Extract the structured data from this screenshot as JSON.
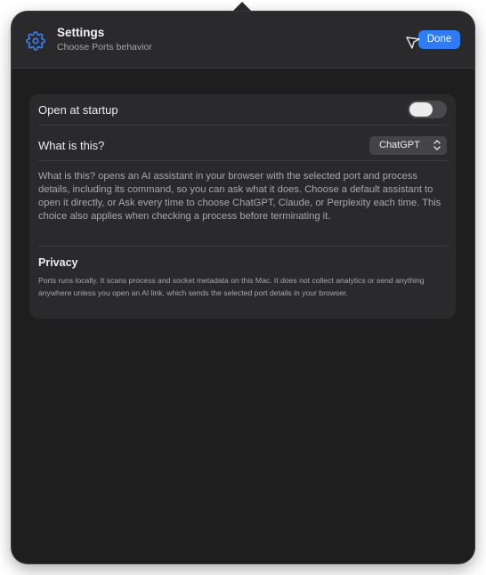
{
  "header": {
    "title": "Settings",
    "subtitle": "Choose Ports behavior",
    "done_label": "Done",
    "settings_icon": "gear-icon",
    "cursor_icon": "pointer-cursor-icon"
  },
  "settings": {
    "open_at_startup": {
      "label": "Open at startup",
      "enabled": false
    },
    "what_is_this": {
      "label": "What is this?",
      "selected": "ChatGPT"
    },
    "description": "What is this? opens an AI assistant in your browser with the selected port and process details, including its command, so you can ask what it does. Choose a default assistant to open it directly, or Ask every time to choose ChatGPT, Claude, or Perplexity each time. This choice also applies when checking a process before terminating it."
  },
  "privacy": {
    "title": "Privacy",
    "text": "Ports runs locally. It scans process and socket metadata on this Mac. It does not collect analytics or send anything anywhere unless you open an AI link, which sends the selected port details in your browser."
  },
  "colors": {
    "accent": "#2f7cf6",
    "panel_background": "#1e1e1e",
    "card_background": "#2a2a2c"
  }
}
